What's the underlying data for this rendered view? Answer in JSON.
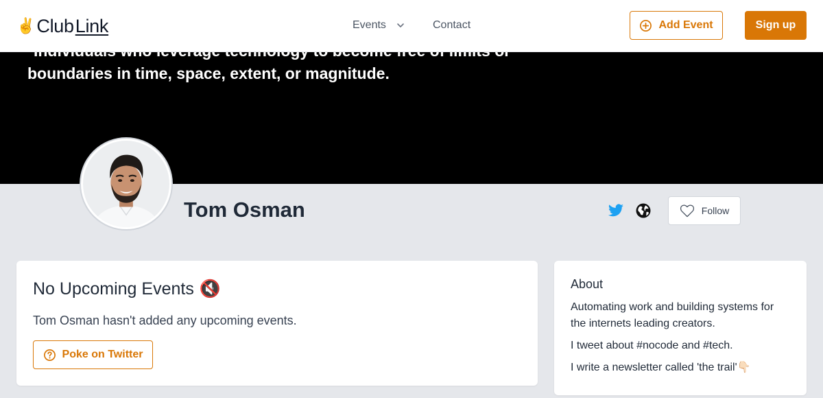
{
  "header": {
    "logo": {
      "hand_emoji": "✌️",
      "club": "Club",
      "link": "Link"
    },
    "nav": {
      "events_label": "Events",
      "contact_label": "Contact"
    },
    "add_event_label": "Add Event",
    "signup_label": "Sign up",
    "accent_color": "#d97706"
  },
  "banner": {
    "quote_line1": "*Individuals who leverage technology to become free of limits or",
    "quote_line2": "boundaries in time, space, extent, or magnitude."
  },
  "profile": {
    "name": "Tom Osman",
    "follow_label": "Follow",
    "twitter_color": "#1da1f2"
  },
  "events": {
    "title": "No Upcoming Events",
    "title_emoji": "🔇",
    "description": "Tom Osman hasn't added any upcoming events.",
    "poke_label": "Poke on Twitter"
  },
  "about": {
    "title": "About",
    "lines": [
      "Automating work and building systems for the internets leading creators.",
      "I tweet about #nocode and #tech.",
      "I write a newsletter called 'the trail'👇🏻"
    ]
  }
}
